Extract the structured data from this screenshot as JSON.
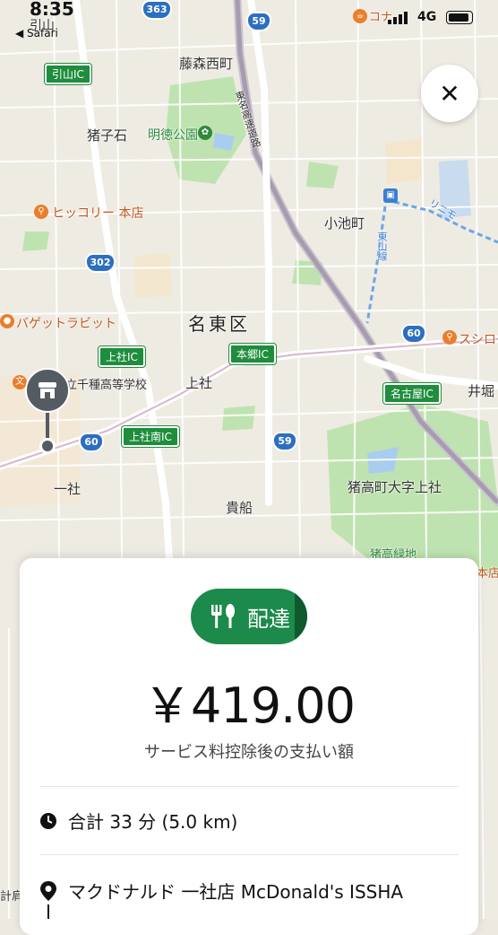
{
  "status_bar": {
    "time": "8:35",
    "back_label": "◀ Safari",
    "network": "4G"
  },
  "map": {
    "labels": {
      "fujimori": "藤森西町",
      "inokoishi": "猪子石",
      "meitoku_park": "明徳公園",
      "hickory": "ヒッコリー 本店",
      "koikecho": "小池町",
      "meito_ku": "名東区",
      "baguette": "バゲットラビット",
      "aichi_school": "愛知県立千種高等学校",
      "kamiyashiro": "上社",
      "isshiki": "一社",
      "kifune": "貴船",
      "igaka": "猪高町大字上社",
      "igaka_green": "猪高緑地",
      "sushiro": "スシロー",
      "igori": "井堀",
      "konana": "コナ",
      "hikiyama": "引山",
      "tomei": "東名高速道路",
      "higashiyama": "東山線",
      "linimo": "リニモ",
      "honten": "本店",
      "tsurikawa": "計肩"
    },
    "ic_labels": {
      "hikiyama_ic": "引山IC",
      "kamiyashiro_ic": "上社IC",
      "hongo_ic": "本郷IC",
      "kamiyashiro_minami_ic": "上社南IC",
      "nagoya_ic": "名古屋IC"
    },
    "route_shields": {
      "r363": "363",
      "r59a": "59",
      "r302": "302",
      "r60a": "60",
      "r60b": "60",
      "r59b": "59"
    }
  },
  "close_button": {
    "label": "✕"
  },
  "card": {
    "mode_label": "配達",
    "price": "￥419.00",
    "price_caption": "サービス料控除後の支払い額",
    "total_time_distance": "合計 33 分 (5.0 km)",
    "pickup": "マクドナルド 一社店 McDonald's ISSHA"
  }
}
